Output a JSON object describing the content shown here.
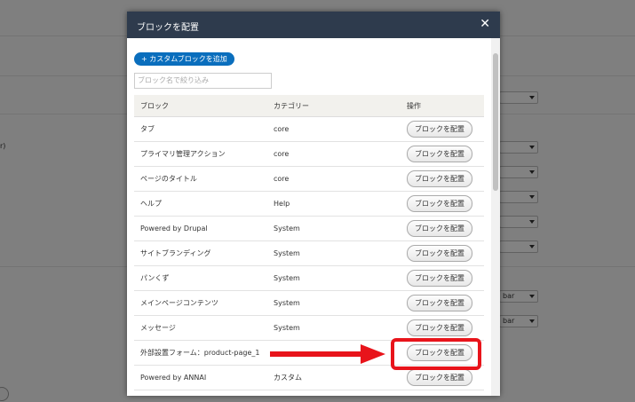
{
  "background": {
    "left_fragment": "r)",
    "select_labels": [
      "",
      "",
      "",
      "",
      "",
      "",
      "",
      "",
      "bar",
      "bar"
    ]
  },
  "dialog": {
    "title": "ブロックを配置",
    "close_symbol": "✕",
    "add_custom_block": "+ カスタムブロックを追加",
    "filter_placeholder": "ブロック名で絞り込み",
    "columns": [
      "ブロック",
      "カテゴリー",
      "操作"
    ],
    "rows": [
      {
        "block": "タブ",
        "category": "core",
        "action": "ブロックを配置"
      },
      {
        "block": "プライマリ管理アクション",
        "category": "core",
        "action": "ブロックを配置"
      },
      {
        "block": "ページのタイトル",
        "category": "core",
        "action": "ブロックを配置"
      },
      {
        "block": "ヘルプ",
        "category": "Help",
        "action": "ブロックを配置"
      },
      {
        "block": "Powered by Drupal",
        "category": "System",
        "action": "ブロックを配置"
      },
      {
        "block": "サイトブランディング",
        "category": "System",
        "action": "ブロックを配置"
      },
      {
        "block": "パンくず",
        "category": "System",
        "action": "ブロックを配置"
      },
      {
        "block": "メインページコンテンツ",
        "category": "System",
        "action": "ブロックを配置"
      },
      {
        "block": "メッセージ",
        "category": "System",
        "action": "ブロックを配置"
      },
      {
        "block": "外部設置フォーム：product-page_1",
        "category": "",
        "action": "ブロックを配置"
      },
      {
        "block": "Powered by ANNAI",
        "category": "カスタム",
        "action": "ブロックを配置"
      }
    ]
  },
  "colors": {
    "titlebar": "#2e3b4d",
    "primary_button": "#0a6ebd",
    "annotation": "#e8141b"
  }
}
